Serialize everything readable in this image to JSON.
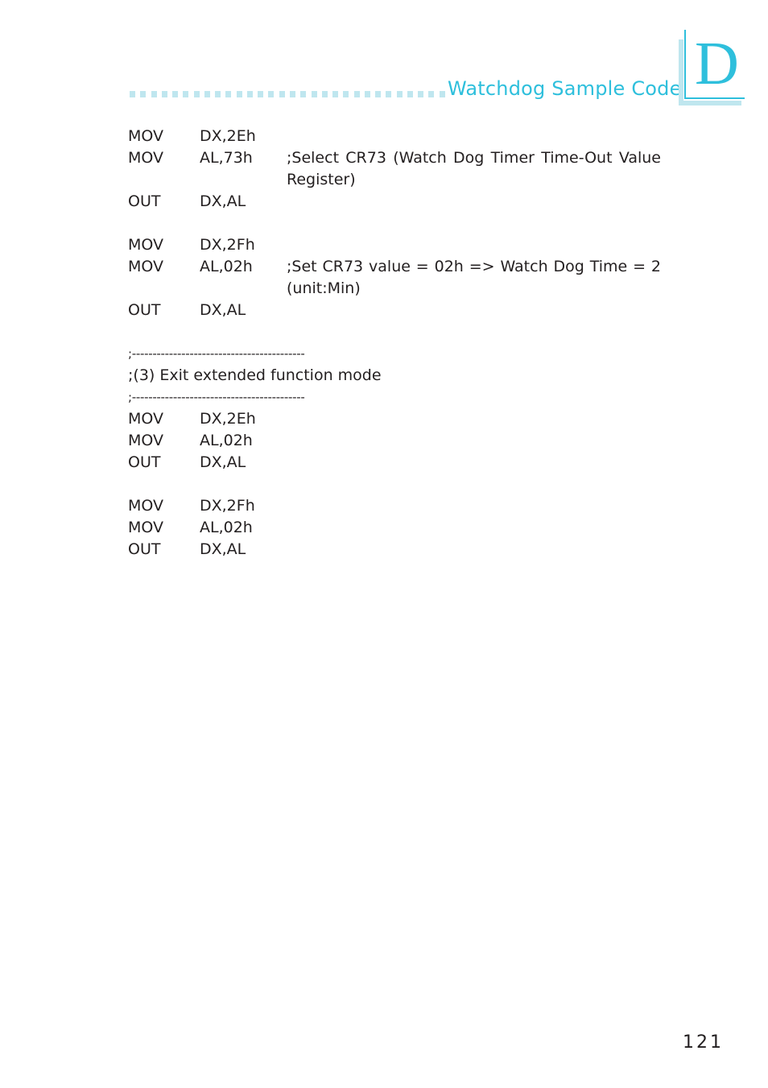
{
  "header": {
    "section_title": "Watchdog Sample Code",
    "appendix_letter": "D",
    "accent_color": "#2ebfdc",
    "accent_light_color": "#bfe6ef"
  },
  "code": {
    "block1": [
      {
        "op": "MOV",
        "arg": "DX,2Eh",
        "comment": ""
      },
      {
        "op": "MOV",
        "arg": "AL,73h",
        "comment": ";Select CR73 (Watch Dog Timer Time-Out Value",
        "comment_cont": "Register)"
      },
      {
        "op": "OUT",
        "arg": "DX,AL",
        "comment": ""
      }
    ],
    "block2": [
      {
        "op": "MOV",
        "arg": "DX,2Fh",
        "comment": ""
      },
      {
        "op": "MOV",
        "arg": "AL,02h",
        "comment": ";Set CR73 value = 02h => Watch Dog Time = 2",
        "comment_cont": "(unit:Min)"
      },
      {
        "op": "OUT",
        "arg": "DX,AL",
        "comment": ""
      }
    ],
    "separator": ";------------------------------------------",
    "section_heading": ";(3) Exit extended function mode",
    "block3": [
      {
        "op": "MOV",
        "arg": "DX,2Eh"
      },
      {
        "op": "MOV",
        "arg": "AL,02h"
      },
      {
        "op": "OUT",
        "arg": "DX,AL"
      }
    ],
    "block4": [
      {
        "op": "MOV",
        "arg": "DX,2Fh"
      },
      {
        "op": "MOV",
        "arg": "AL,02h"
      },
      {
        "op": "OUT",
        "arg": "DX,AL"
      }
    ]
  },
  "footer": {
    "page_number": "121"
  }
}
